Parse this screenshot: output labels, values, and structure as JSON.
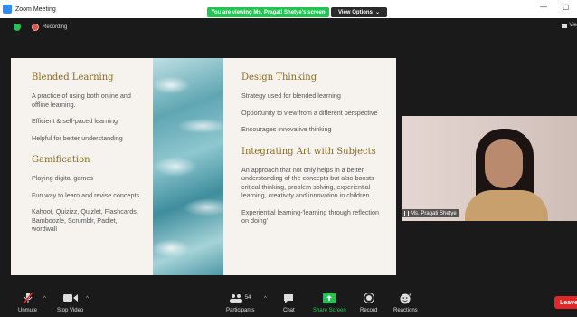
{
  "window": {
    "title": "Zoom Meeting",
    "share_banner": "You are viewing Ms. Pragati Shetye's screen",
    "view_options": "View Options",
    "view_options_caret": "⌄",
    "minimize": "—",
    "maximize": "▢"
  },
  "status": {
    "recording": "Recording",
    "view_label": "Vie"
  },
  "slide": {
    "left": {
      "section1_title": "Blended Learning",
      "section1_points": [
        "A practice of using both online and offline learning.",
        "Efficient & self-paced learning",
        "Helpful for better understanding"
      ],
      "section2_title": "Gamification",
      "section2_points": [
        "Playing digital games",
        "Fun way to learn and revise concepts",
        "Kahoot, Quizizz, Quizlet, Flashcards, Bamboozle, Scrumblr, Padlet, wordwall"
      ]
    },
    "right": {
      "section1_title": "Design Thinking",
      "section1_points": [
        "Strategy used for blended learning",
        "Opportunity to view from a different perspective",
        "Encourages innovative thinking"
      ],
      "section2_title": "Integrating Art with Subjects",
      "section2_points": [
        "An approach that not only helps in a better understanding of the concepts but also boosts critical thinking, problem solving, experiential learning, creativity and innovation in children.",
        "Experiential learning-'learning through reflection on doing'"
      ]
    }
  },
  "participant": {
    "name": "Ms. Pragati Shetye"
  },
  "toolbar": {
    "unmute": "Unmute",
    "stop_video": "Stop Video",
    "participants": "Participants",
    "participants_count": "54",
    "chat": "Chat",
    "share_screen": "Share Screen",
    "record": "Record",
    "reactions": "Reactions",
    "leave": "Leave",
    "caret": "^"
  },
  "colors": {
    "accent_green": "#23c552",
    "zoom_blue": "#2d8cff",
    "leave_red": "#e02828",
    "slide_heading": "#8a6a1f"
  }
}
